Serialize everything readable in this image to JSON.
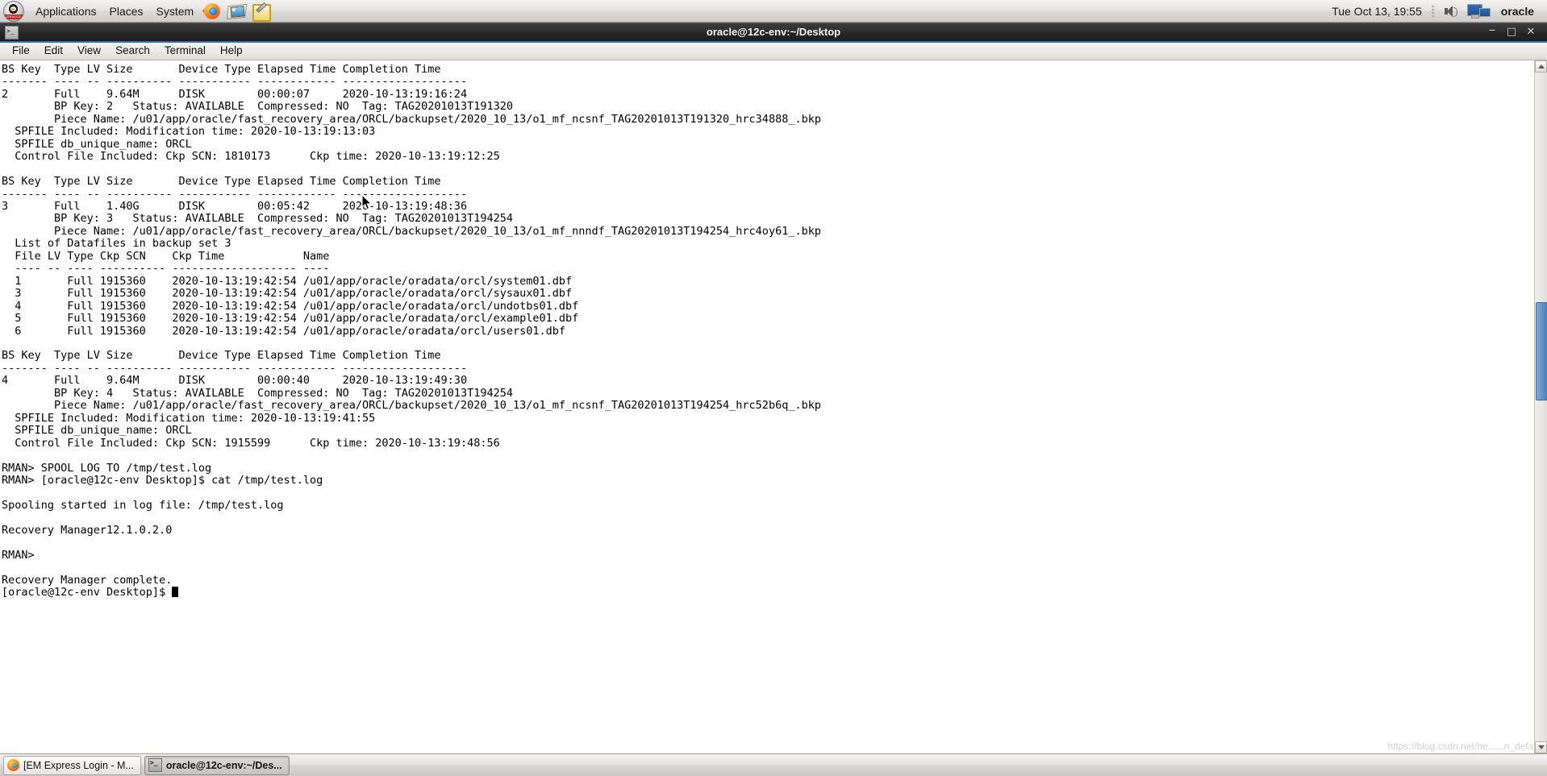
{
  "top_panel": {
    "logo_label": "ORACLE",
    "menus": [
      {
        "name": "applications",
        "label": "Applications"
      },
      {
        "name": "places",
        "label": "Places"
      },
      {
        "name": "system",
        "label": "System"
      }
    ],
    "launchers": [
      {
        "name": "firefox-launcher-icon",
        "icon": "firefox-icon"
      },
      {
        "name": "image-viewer-launcher-icon",
        "icon": "image-viewer-icon"
      },
      {
        "name": "text-editor-launcher-icon",
        "icon": "text-editor-icon"
      }
    ],
    "clock": "Tue Oct 13, 19:55",
    "volume_icon": "volume-icon",
    "display_icon": "display-icon",
    "username": "oracle"
  },
  "window": {
    "title": "oracle@12c-env:~/Desktop",
    "icon": "terminal-icon",
    "controls": {
      "minimize": "–",
      "maximize": "□",
      "close": "✕"
    },
    "menubar": [
      {
        "name": "menu-file",
        "label": "File"
      },
      {
        "name": "menu-edit",
        "label": "Edit"
      },
      {
        "name": "menu-view",
        "label": "View"
      },
      {
        "name": "menu-search",
        "label": "Search"
      },
      {
        "name": "menu-terminal",
        "label": "Terminal"
      },
      {
        "name": "menu-help",
        "label": "Help"
      }
    ]
  },
  "terminal": {
    "content": "BS Key  Type LV Size       Device Type Elapsed Time Completion Time\n------- ---- -- ---------- ----------- ------------ -------------------\n2       Full    9.64M      DISK        00:00:07     2020-10-13:19:16:24\n        BP Key: 2   Status: AVAILABLE  Compressed: NO  Tag: TAG20201013T191320\n        Piece Name: /u01/app/oracle/fast_recovery_area/ORCL/backupset/2020_10_13/o1_mf_ncsnf_TAG20201013T191320_hrc34888_.bkp\n  SPFILE Included: Modification time: 2020-10-13:19:13:03\n  SPFILE db_unique_name: ORCL\n  Control File Included: Ckp SCN: 1810173      Ckp time: 2020-10-13:19:12:25\n\nBS Key  Type LV Size       Device Type Elapsed Time Completion Time\n------- ---- -- ---------- ----------- ------------ -------------------\n3       Full    1.40G      DISK        00:05:42     2020-10-13:19:48:36\n        BP Key: 3   Status: AVAILABLE  Compressed: NO  Tag: TAG20201013T194254\n        Piece Name: /u01/app/oracle/fast_recovery_area/ORCL/backupset/2020_10_13/o1_mf_nnndf_TAG20201013T194254_hrc4oy61_.bkp\n  List of Datafiles in backup set 3\n  File LV Type Ckp SCN    Ckp Time            Name\n  ---- -- ---- ---------- ------------------- ----\n  1       Full 1915360    2020-10-13:19:42:54 /u01/app/oracle/oradata/orcl/system01.dbf\n  3       Full 1915360    2020-10-13:19:42:54 /u01/app/oracle/oradata/orcl/sysaux01.dbf\n  4       Full 1915360    2020-10-13:19:42:54 /u01/app/oracle/oradata/orcl/undotbs01.dbf\n  5       Full 1915360    2020-10-13:19:42:54 /u01/app/oracle/oradata/orcl/example01.dbf\n  6       Full 1915360    2020-10-13:19:42:54 /u01/app/oracle/oradata/orcl/users01.dbf\n\nBS Key  Type LV Size       Device Type Elapsed Time Completion Time\n------- ---- -- ---------- ----------- ------------ -------------------\n4       Full    9.64M      DISK        00:00:40     2020-10-13:19:49:30\n        BP Key: 4   Status: AVAILABLE  Compressed: NO  Tag: TAG20201013T194254\n        Piece Name: /u01/app/oracle/fast_recovery_area/ORCL/backupset/2020_10_13/o1_mf_ncsnf_TAG20201013T194254_hrc52b6q_.bkp\n  SPFILE Included: Modification time: 2020-10-13:19:41:55\n  SPFILE db_unique_name: ORCL\n  Control File Included: Ckp SCN: 1915599      Ckp time: 2020-10-13:19:48:56\n\nRMAN> SPOOL LOG TO /tmp/test.log\nRMAN> [oracle@12c-env Desktop]$ cat /tmp/test.log\n\nSpooling started in log file: /tmp/test.log\n\nRecovery Manager12.1.0.2.0\n\nRMAN>\n\nRecovery Manager complete.\n[oracle@12c-env Desktop]$ ",
    "scrollbar": {
      "name": "terminal-scrollbar"
    },
    "watermark": "https://blog.csdn.net/he......n_default"
  },
  "taskbar": {
    "items": [
      {
        "name": "taskbar-item-firefox",
        "icon": "firefox-icon",
        "label": "[EM Express Login - M...",
        "active": false
      },
      {
        "name": "taskbar-item-terminal",
        "icon": "terminal-icon",
        "label": "oracle@12c-env:~/Des...",
        "active": true
      }
    ]
  }
}
